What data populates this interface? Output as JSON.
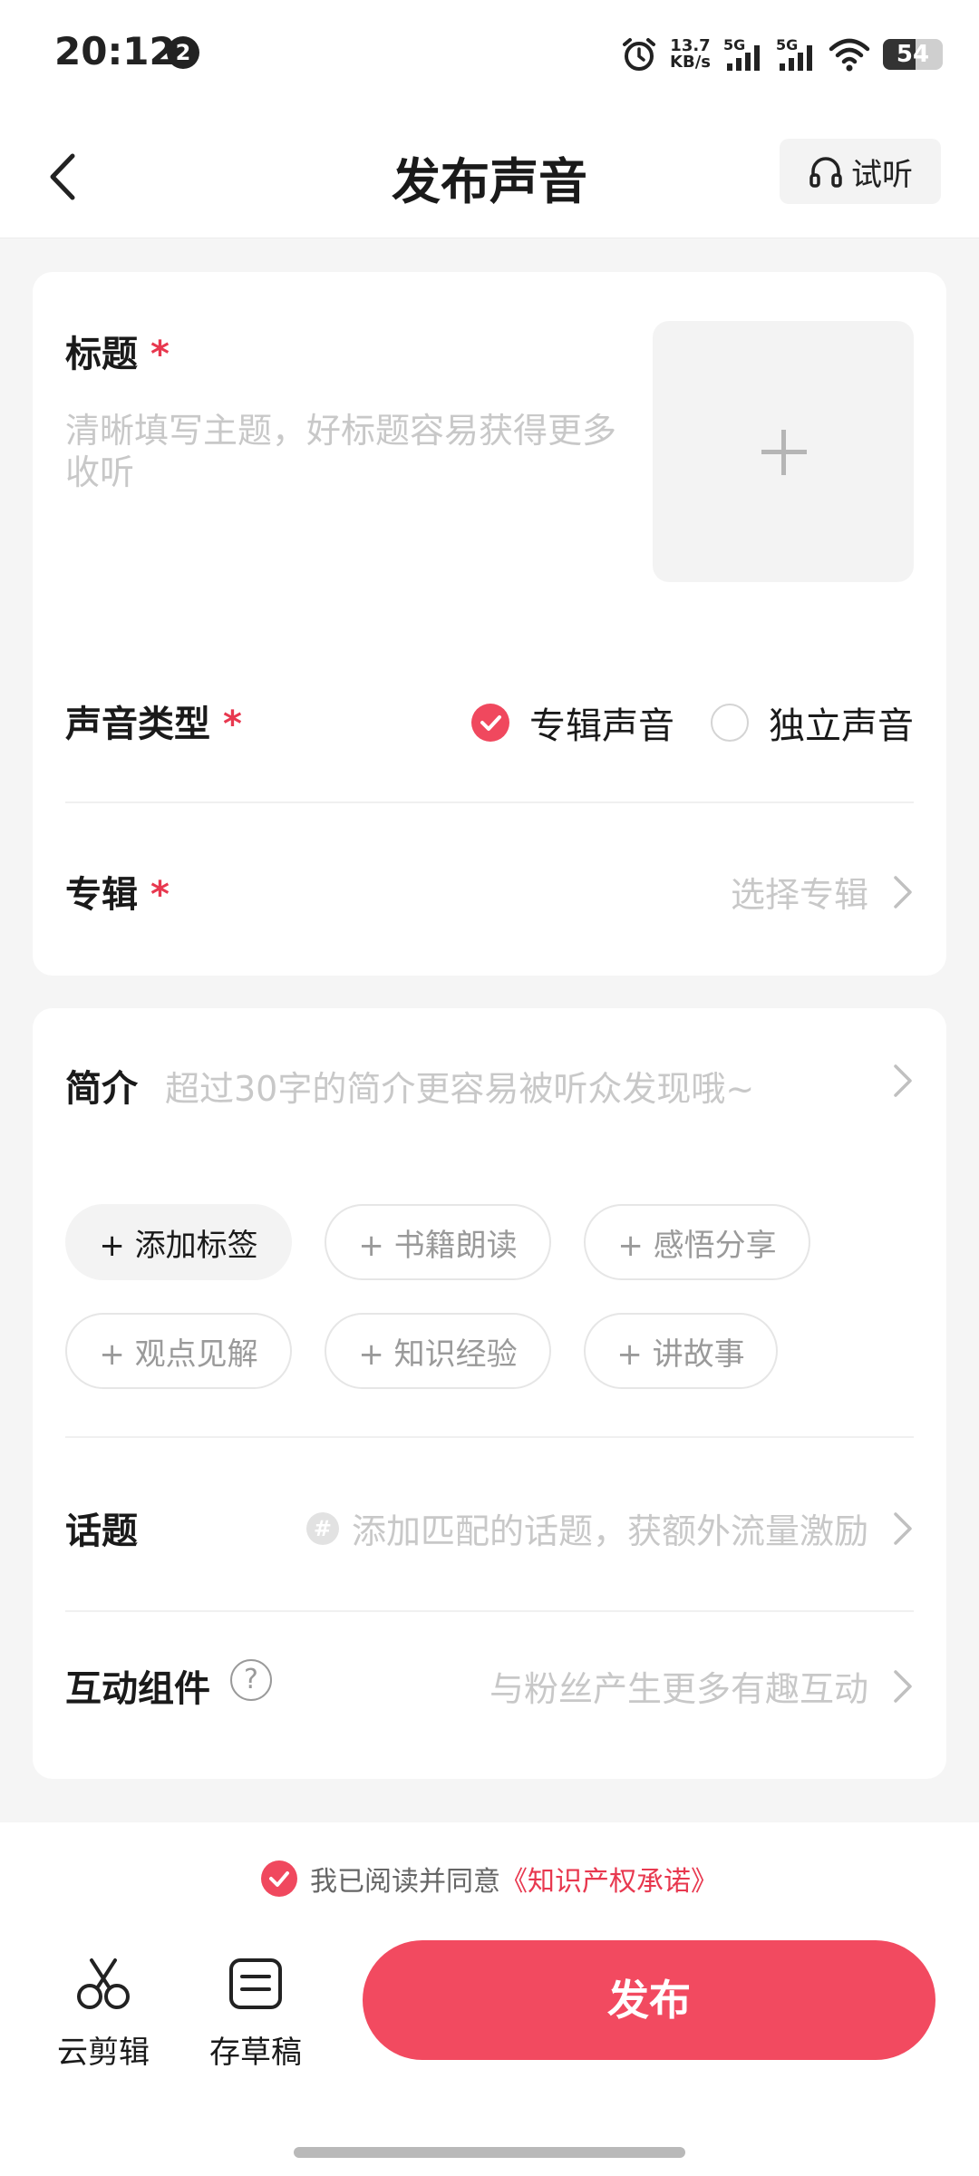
{
  "status_bar": {
    "time": "20:12",
    "notification_count": "2",
    "net_speed_value": "13.7",
    "net_speed_unit": "KB/s",
    "signal1_label": "5G",
    "signal2_label": "5G",
    "battery_level": "54",
    "battery_fraction": 0.54
  },
  "header": {
    "title": "发布声音",
    "preview_label": "试听"
  },
  "form": {
    "title_label": "标题",
    "required_mark": "*",
    "title_placeholder": "清晰填写主题，好标题容易获得更多收听",
    "sound_type_label": "声音类型",
    "sound_type_options": [
      {
        "label": "专辑声音",
        "selected": true
      },
      {
        "label": "独立声音",
        "selected": false
      }
    ],
    "album_label": "专辑",
    "album_placeholder": "选择专辑",
    "intro_label": "简介",
    "intro_placeholder": "超过30字的简介更容易被听众发现哦~",
    "tags": [
      "+ 添加标签",
      "+ 书籍朗读",
      "+ 感悟分享",
      "+ 观点见解",
      "+ 知识经验",
      "+ 讲故事"
    ],
    "topic_label": "话题",
    "topic_icon_glyph": "#",
    "topic_placeholder": "添加匹配的话题，获额外流量激励",
    "interaction_label": "互动组件",
    "help_glyph": "?",
    "interaction_placeholder": "与粉丝产生更多有趣互动"
  },
  "footer": {
    "agree_text": "我已阅读并同意",
    "agreement_link": "《知识产权承诺》",
    "tools": [
      {
        "label": "云剪辑",
        "icon": "scissors-icon"
      },
      {
        "label": "存草稿",
        "icon": "draft-icon"
      }
    ],
    "publish_label": "发布"
  },
  "colors": {
    "accent": "#f24a60",
    "placeholder": "#c8c8c8"
  }
}
